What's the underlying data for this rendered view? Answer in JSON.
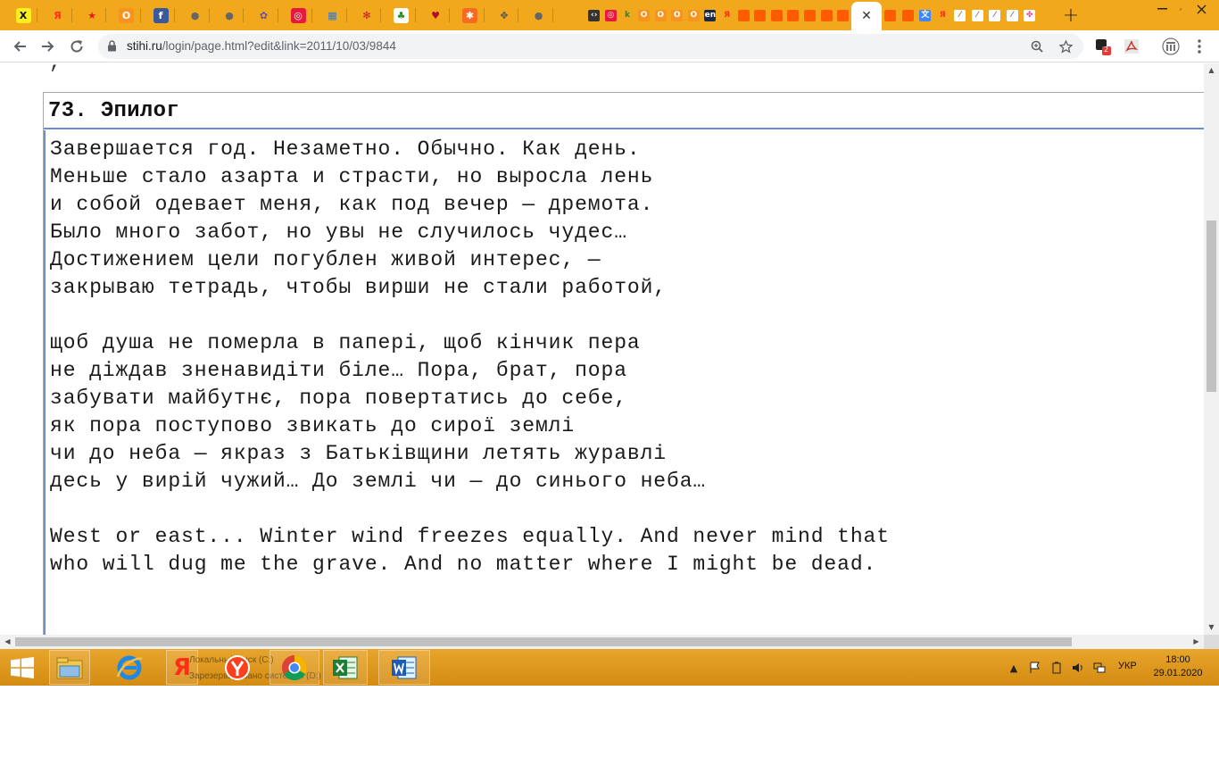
{
  "browser": {
    "url_host": "stihi.ru",
    "url_path": "/login/page.html?edit&link=2011/10/03/9844",
    "pinned_tabs": [
      {
        "icon": "raiffeisen-icon",
        "glyph": "X",
        "bg": "#fcee21",
        "fg": "#111"
      },
      {
        "icon": "yandex-icon",
        "glyph": "Я",
        "bg": "transparent",
        "fg": "#ff2d1a"
      },
      {
        "icon": "star-bookmark-icon",
        "glyph": "★",
        "bg": "transparent",
        "fg": "#e41b1b"
      },
      {
        "icon": "odnoklassniki-icon",
        "glyph": "O",
        "bg": "#f7931e",
        "fg": "#fff"
      },
      {
        "icon": "facebook-icon",
        "glyph": "f",
        "bg": "#3b5998",
        "fg": "#fff"
      },
      {
        "icon": "globe-icon",
        "glyph": "●",
        "bg": "transparent",
        "fg": "#666"
      },
      {
        "icon": "globe-icon",
        "glyph": "●",
        "bg": "transparent",
        "fg": "#666"
      },
      {
        "icon": "ladybird-icon",
        "glyph": "✿",
        "bg": "transparent",
        "fg": "#6b4fa0"
      },
      {
        "icon": "ring-icon",
        "glyph": "◎",
        "bg": "#e8183b",
        "fg": "#fff"
      },
      {
        "icon": "windows-grid-icon",
        "glyph": "▦",
        "bg": "transparent",
        "fg": "#2f7bd6"
      },
      {
        "icon": "ladybug-icon",
        "glyph": "✻",
        "bg": "transparent",
        "fg": "#c0182b"
      },
      {
        "icon": "leaf-icon",
        "glyph": "♣",
        "bg": "#ffffff",
        "fg": "#2e8b2e"
      },
      {
        "icon": "cherry-icon",
        "glyph": "♥",
        "bg": "transparent",
        "fg": "#b10d2a"
      },
      {
        "icon": "puzzle-icon",
        "glyph": "✱",
        "bg": "#f56b1f",
        "fg": "#fff"
      },
      {
        "icon": "move-arrows-icon",
        "glyph": "✥",
        "bg": "transparent",
        "fg": "#555"
      },
      {
        "icon": "globe-icon",
        "glyph": "●",
        "bg": "transparent",
        "fg": "#666"
      }
    ],
    "small_tabs": [
      {
        "icon": "code-icon",
        "glyph": "‹›",
        "bg": "#333",
        "fg": "#fff"
      },
      {
        "icon": "ring-icon",
        "glyph": "◎",
        "bg": "#e8183b",
        "fg": "#fff"
      },
      {
        "icon": "kinopoisk-icon",
        "glyph": "k",
        "bg": "transparent",
        "fg": "#1f8a3b"
      },
      {
        "icon": "odnoklassniki-icon",
        "glyph": "O",
        "bg": "#f7931e",
        "fg": "#fff"
      },
      {
        "icon": "odnoklassniki-icon",
        "glyph": "O",
        "bg": "#f7931e",
        "fg": "#fff"
      },
      {
        "icon": "odnoklassniki-icon",
        "glyph": "O",
        "bg": "#f7931e",
        "fg": "#fff"
      },
      {
        "icon": "odnoklassniki-icon",
        "glyph": "O",
        "bg": "#f7931e",
        "fg": "#fff"
      },
      {
        "icon": "en-dictionary-icon",
        "glyph": "en",
        "bg": "#1b2a4a",
        "fg": "#fff"
      },
      {
        "icon": "yandex-icon",
        "glyph": "Я",
        "bg": "transparent",
        "fg": "#ff2d1a"
      },
      {
        "icon": "orange-square-icon",
        "glyph": "",
        "bg": "#ff5b00",
        "fg": "#fff"
      },
      {
        "icon": "orange-square-icon",
        "glyph": "",
        "bg": "#ff5b00",
        "fg": "#fff"
      },
      {
        "icon": "orange-square-icon",
        "glyph": "",
        "bg": "#ff5b00",
        "fg": "#fff"
      },
      {
        "icon": "orange-square-icon",
        "glyph": "",
        "bg": "#ff5b00",
        "fg": "#fff"
      },
      {
        "icon": "orange-square-icon",
        "glyph": "",
        "bg": "#ff5b00",
        "fg": "#fff"
      },
      {
        "icon": "orange-square-icon",
        "glyph": "",
        "bg": "#ff5b00",
        "fg": "#fff"
      },
      {
        "icon": "orange-square-icon",
        "glyph": "",
        "bg": "#ff5b00",
        "fg": "#fff"
      }
    ],
    "right_tabs": [
      {
        "icon": "orange-square-icon",
        "glyph": "",
        "bg": "#ff5b00",
        "fg": "#fff"
      },
      {
        "icon": "orange-square-icon",
        "glyph": "",
        "bg": "#ff5b00",
        "fg": "#fff"
      },
      {
        "icon": "translate-icon",
        "glyph": "文",
        "bg": "#4285f4",
        "fg": "#fff"
      },
      {
        "icon": "yandex-icon",
        "glyph": "Я",
        "bg": "transparent",
        "fg": "#ff2d1a"
      },
      {
        "icon": "feather-icon",
        "glyph": "⁄",
        "bg": "#ffffff",
        "fg": "#777"
      },
      {
        "icon": "feather-icon",
        "glyph": "⁄",
        "bg": "#ffffff",
        "fg": "#777"
      },
      {
        "icon": "feather-icon",
        "glyph": "⁄",
        "bg": "#ffffff",
        "fg": "#777"
      },
      {
        "icon": "feather-icon",
        "glyph": "⁄",
        "bg": "#ffffff",
        "fg": "#777"
      },
      {
        "icon": "colorful-pinwheel-icon",
        "glyph": "✤",
        "bg": "#ffffff",
        "fg": "#e04a9b"
      }
    ],
    "active_tab_close": "✕",
    "new_tab": "+",
    "extensions_badge": "2"
  },
  "page": {
    "previous_line_fragment": "  ,     ",
    "poem_title": "73. Эпилог",
    "poem_lines": [
      "Завершается год. Незаметно. Обычно. Как день.",
      "Меньше стало азарта и страсти, но выросла лень",
      "и собой одевает меня, как под вечер — дремота.",
      "Было много забот, но увы не случилось чудес…",
      "Достижением цели погублен живой интерес, —",
      "закрываю тетрадь, чтобы вирши не стали работой,",
      "",
      "щоб душа не померла в папері, щоб кінчик пера",
      "не діждав зненавидіти біле… Пора, брат, пора",
      "забувати майбутнє, пора повертатись до себе,",
      "як пора поступово звикать до сирої землі",
      "чи до неба — якраз з Батьківщини летять журавлі",
      "десь у вирій чужий… До землі чи — до синього неба…",
      "",
      "West or east... Winter wind freezes equally. And never mind that",
      "who will dug me the grave. And no matter where I might be dead."
    ]
  },
  "taskbar": {
    "yandex_tooltip_line1": "Локальный диск (C:)",
    "yandex_tooltip_line2": "Зарезервировано системой (D:)",
    "language": "УКР",
    "time": "18:00",
    "date": "29.01.2020"
  },
  "colors": {
    "tabstrip": "#f2a81c",
    "taskbar": "#e09a20",
    "focus_border": "#6a8fd6"
  }
}
